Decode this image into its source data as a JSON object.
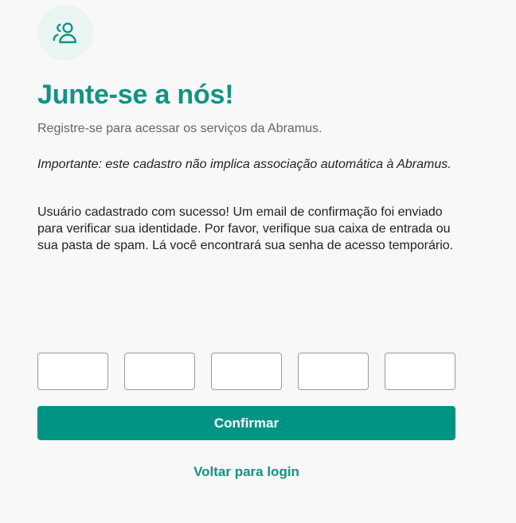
{
  "header": {
    "icon": "users-icon",
    "title": "Junte-se a nós!",
    "subtitle": "Registre-se para acessar os serviços da Abramus."
  },
  "notice": {
    "important": "Importante: este cadastro não implica associação automática à Abramus.",
    "success": "Usuário cadastrado com sucesso! Um email de confirmação foi enviado para verificar sua identidade. Por favor, verifique sua caixa de entrada ou sua pasta de spam. Lá você encontrará sua senha de acesso temporário."
  },
  "code_inputs": [
    "",
    "",
    "",
    "",
    ""
  ],
  "actions": {
    "confirm_label": "Confirmar",
    "back_label": "Voltar para login"
  },
  "colors": {
    "accent": "#009485",
    "icon_bg": "#eaf5f3",
    "background": "#f8f8f8"
  }
}
